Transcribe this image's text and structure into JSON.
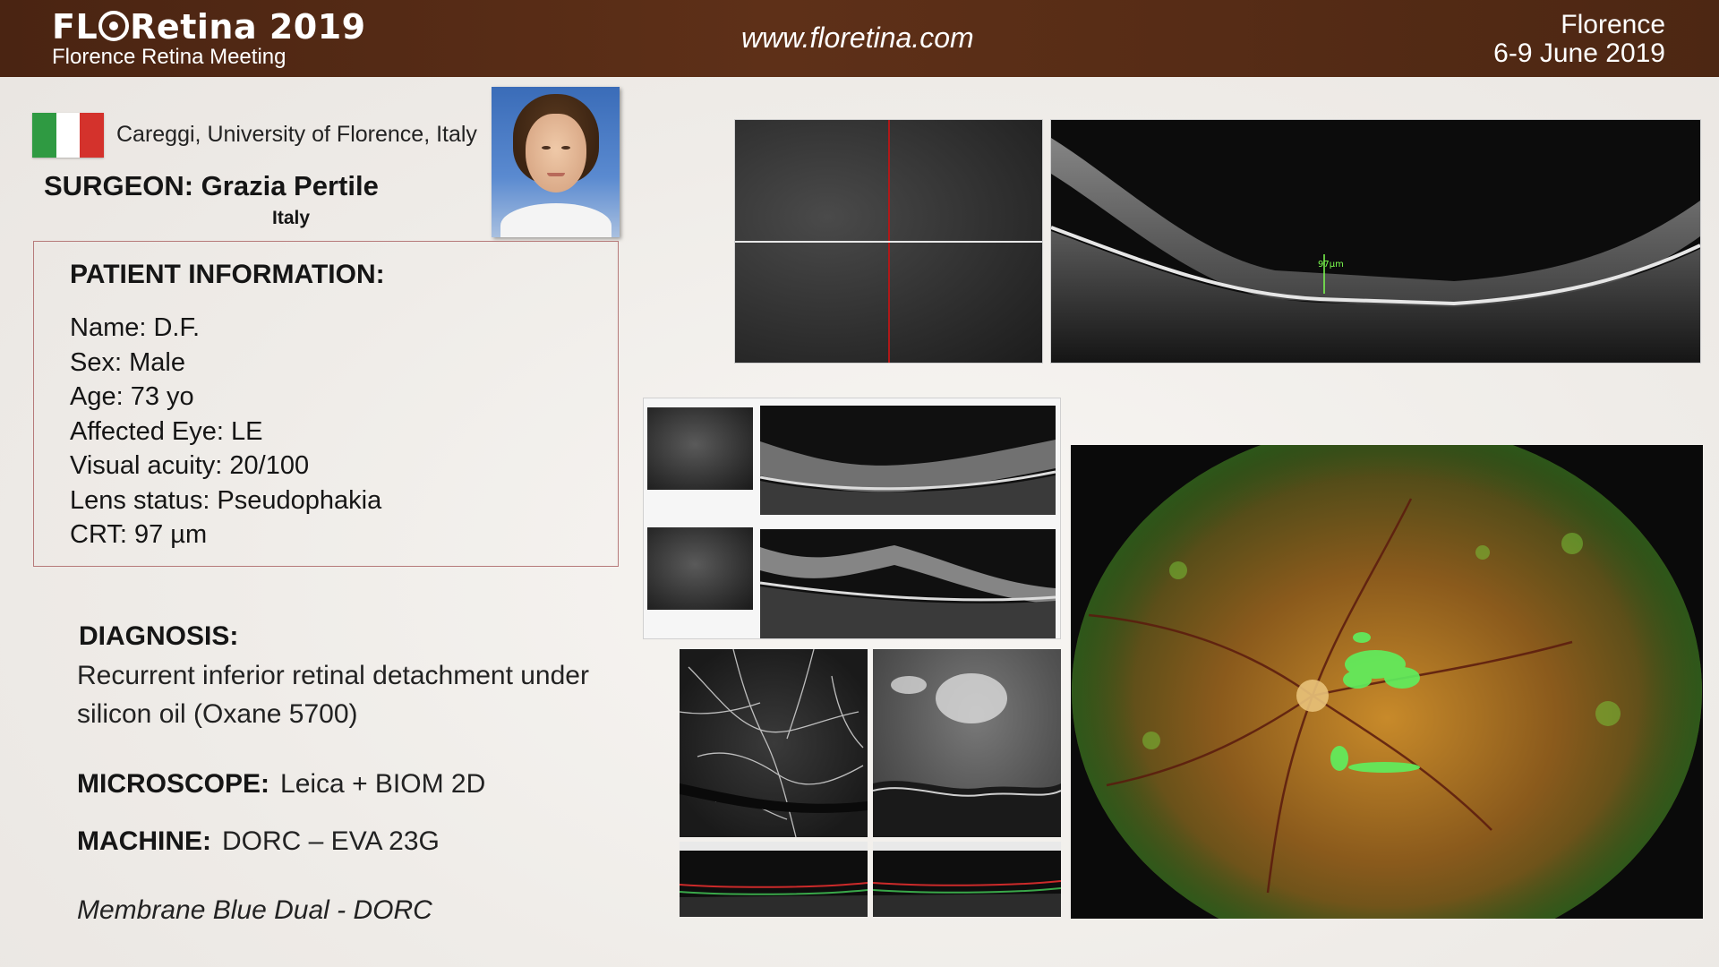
{
  "header": {
    "brand_prefix": "FL",
    "brand_suffix": "Retina 2019",
    "subtitle": "Florence Retina Meeting",
    "url": "www.floretina.com",
    "city": "Florence",
    "dates": "6-9 June 2019"
  },
  "surgeon_block": {
    "flag_icon": "italy-flag-icon",
    "affiliation": "Careggi, University of Florence, Italy",
    "surgeon_line": "SURGEON: Grazia Pertile",
    "country": "Italy"
  },
  "patient": {
    "title": "PATIENT INFORMATION:",
    "items": [
      "Name: D.F.",
      "Sex: Male",
      "Age: 73 yo",
      "Affected Eye: LE",
      "Visual acuity: 20/100",
      "Lens status: Pseudophakia",
      "CRT: 97 µm"
    ]
  },
  "diagnosis": {
    "heading": "DIAGNOSIS:",
    "text": "Recurrent inferior retinal detachment under silicon oil (Oxane 5700)"
  },
  "equipment": {
    "microscope_label": "MICROSCOPE:",
    "microscope_value": "Leica + BIOM 2D",
    "machine_label": "MACHINE:",
    "machine_value": "DORC – EVA 23G"
  },
  "note": "Membrane Blue Dual - DORC",
  "images": {
    "oct_measurement": "97µm"
  },
  "colors": {
    "header_bg": "#5e3018",
    "patient_border": "#b67a7a",
    "scan_line": "#b01818",
    "fluo_green": "#5ef05e"
  }
}
